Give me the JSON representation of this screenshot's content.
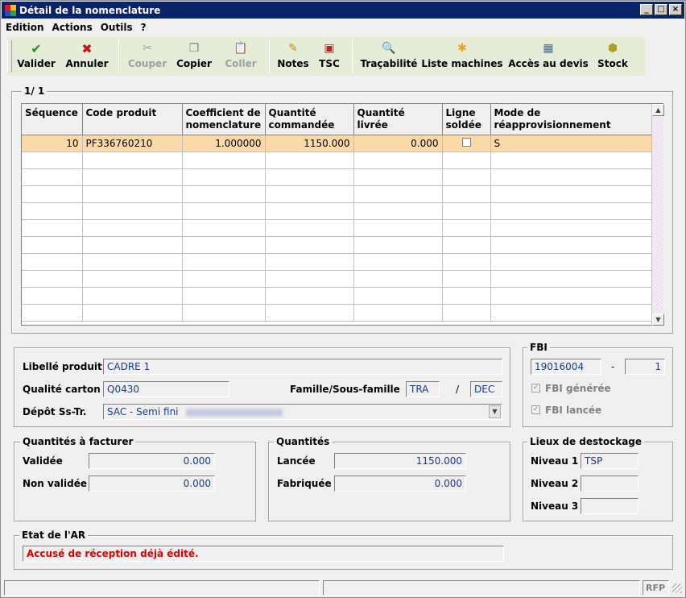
{
  "window": {
    "title": "Détail de la nomenclature"
  },
  "menu": [
    "Edition",
    "Actions",
    "Outils",
    "?"
  ],
  "toolbar": {
    "validate": "Valider",
    "cancel": "Annuler",
    "cut": "Couper",
    "copy": "Copier",
    "paste": "Coller",
    "notes": "Notes",
    "tsc": "TSC",
    "traceability": "Traçabilité",
    "machines": "Liste machines",
    "quote": "Accès au devis",
    "stock": "Stock"
  },
  "grid": {
    "counter": "1/ 1",
    "headers": [
      "Séquence",
      "Code produit",
      "Coefficient de nomenclature",
      "Quantité commandée",
      "Quantité livrée",
      "Ligne soldée",
      "Mode de réapprovisionnement"
    ],
    "rows": [
      {
        "sequence": "10",
        "code": "PF336760210",
        "coef": "1.000000",
        "qty_ordered": "1150.000",
        "qty_delivered": "0.000",
        "closed": false,
        "mode": "S"
      }
    ]
  },
  "product": {
    "label_libelle": "Libellé produit",
    "libelle": "CADRE 1",
    "label_qualite": "Qualité carton",
    "qualite": "Q0430",
    "label_famille": "Famille/Sous-famille",
    "famille": "TRA",
    "sep": "/",
    "sous_famille": "DEC",
    "label_depot": "Dépôt Ss-Tr.",
    "depot": "SAC - Semi fini"
  },
  "fbi": {
    "legend": "FBI",
    "number": "19016004",
    "dash": "-",
    "index": "1",
    "generated_label": "FBI générée",
    "generated": true,
    "launched_label": "FBI lancée",
    "launched": true
  },
  "invoice_qty": {
    "legend": "Quantités à facturer",
    "validated_label": "Validée",
    "validated": "0.000",
    "unvalidated_label": "Non validée",
    "unvalidated": "0.000"
  },
  "quantities": {
    "legend": "Quantités",
    "launched_label": "Lancée",
    "launched": "1150.000",
    "made_label": "Fabriquée",
    "made": "0.000"
  },
  "destock": {
    "legend": "Lieux de destockage",
    "n1_label": "Niveau 1",
    "n1": "TSP",
    "n2_label": "Niveau 2",
    "n2": "",
    "n3_label": "Niveau 3",
    "n3": ""
  },
  "ar": {
    "legend": "Etat de l'AR",
    "message": "Accusé de réception déjà édité.",
    "color": "#e00000"
  },
  "status": {
    "right": "RFP"
  }
}
